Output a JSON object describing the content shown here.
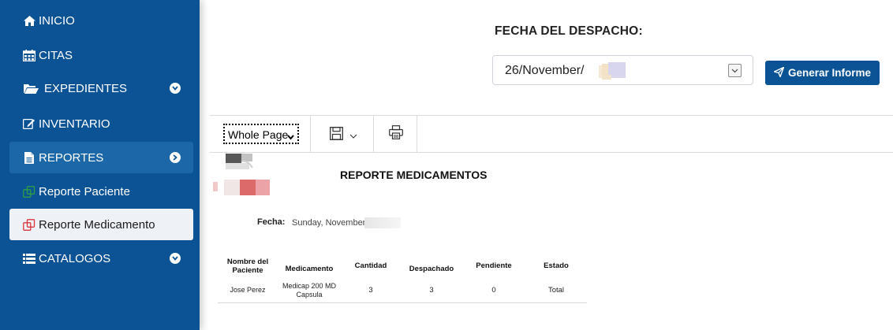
{
  "sidebar": {
    "items": [
      {
        "label": "INICIO",
        "icon": "home-icon"
      },
      {
        "label": "CITAS",
        "icon": "calendar-icon"
      },
      {
        "label": "EXPEDIENTES",
        "icon": "folder-open-icon"
      },
      {
        "label": "INVENTARIO",
        "icon": "edit-icon"
      },
      {
        "label": "REPORTES",
        "icon": "file-icon"
      },
      {
        "label": "Reporte Paciente",
        "icon": "copy-icon"
      },
      {
        "label": "Reporte Medicamento",
        "icon": "copy-icon"
      },
      {
        "label": "CATALOGOS",
        "icon": "list-icon"
      }
    ]
  },
  "form": {
    "fecha_label": "FECHA DEL DESPACHO:",
    "date_value": "26/November/",
    "generate_button": "Generar Informe"
  },
  "toolbar": {
    "zoom_value": "Whole Page"
  },
  "report": {
    "title": "REPORTE MEDICAMENTOS",
    "fecha_label": "Fecha:",
    "fecha_value": "Sunday, November",
    "columns": [
      "Nombre del Paciente",
      "Medicamento",
      "Cantidad",
      "Despachado",
      "Pendiente",
      "Estado"
    ],
    "rows": [
      {
        "paciente": "Jose Perez",
        "medicamento": "Medicap 200 MD Capsula",
        "cantidad": "3",
        "despachado": "3",
        "pendiente": "0",
        "estado": "Total"
      }
    ]
  },
  "colors": {
    "sidebar_bg": "#0b5394",
    "accent_green": "#2e9e44",
    "accent_red": "#d9363e",
    "pending_red": "#c00000"
  }
}
